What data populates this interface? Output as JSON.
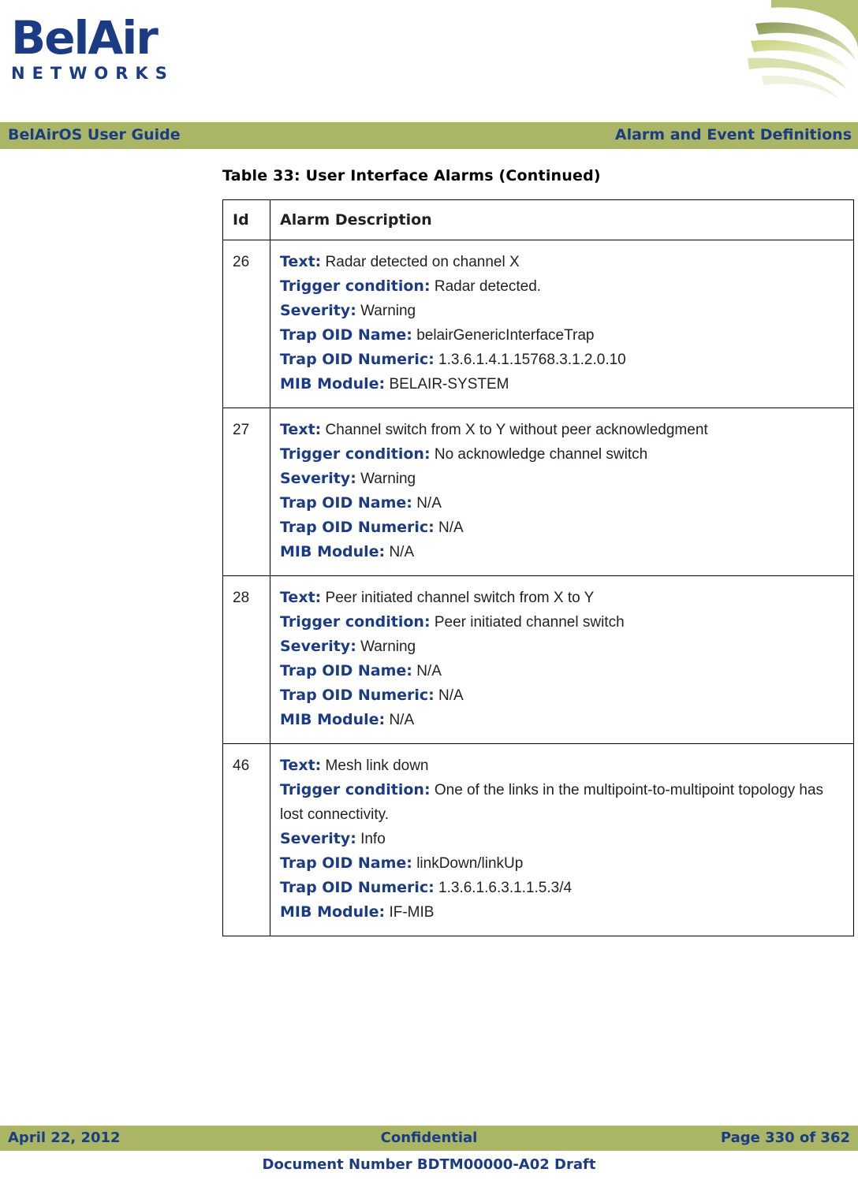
{
  "brand": {
    "logo_main": "BelAir",
    "logo_sub": "NETWORKS",
    "accent_color": "#1b3c84",
    "band_color": "#aab666"
  },
  "header": {
    "left": "BelAirOS User Guide",
    "right": "Alarm and Event Definitions"
  },
  "table": {
    "caption": "Table 33: User Interface Alarms  (Continued)",
    "columns": [
      "Id",
      "Alarm Description"
    ],
    "rows": [
      {
        "id": "26",
        "fields": [
          {
            "label": "Text:",
            "value": "Radar detected on channel X"
          },
          {
            "label": "Trigger condition:",
            "value": "Radar detected."
          },
          {
            "label": "Severity:",
            "value": "Warning"
          },
          {
            "label": "Trap OID Name:",
            "value": "belairGenericInterfaceTrap"
          },
          {
            "label": "Trap OID Numeric:",
            "value": "1.3.6.1.4.1.15768.3.1.2.0.10"
          },
          {
            "label": "MIB Module:",
            "value": "BELAIR-SYSTEM"
          }
        ]
      },
      {
        "id": "27",
        "fields": [
          {
            "label": "Text:",
            "value": "Channel switch from X to Y without peer acknowledgment"
          },
          {
            "label": "Trigger condition:",
            "value": "No acknowledge channel switch"
          },
          {
            "label": "Severity:",
            "value": "Warning"
          },
          {
            "label": "Trap OID Name:",
            "value": "N/A"
          },
          {
            "label": "Trap OID Numeric:",
            "value": "N/A"
          },
          {
            "label": "MIB Module:",
            "value": "N/A"
          }
        ]
      },
      {
        "id": "28",
        "fields": [
          {
            "label": "Text:",
            "value": "Peer initiated channel switch from X to Y"
          },
          {
            "label": "Trigger condition:",
            "value": "Peer initiated channel switch"
          },
          {
            "label": "Severity:",
            "value": "Warning"
          },
          {
            "label": "Trap OID Name:",
            "value": "N/A"
          },
          {
            "label": "Trap OID Numeric:",
            "value": "N/A"
          },
          {
            "label": "MIB Module:",
            "value": "N/A"
          }
        ]
      },
      {
        "id": "46",
        "fields": [
          {
            "label": "Text:",
            "value": "Mesh link down"
          },
          {
            "label": "Trigger condition:",
            "value": "One of the links in the multipoint-to-multipoint topology has lost connectivity."
          },
          {
            "label": "Severity:",
            "value": "Info"
          },
          {
            "label": "Trap OID Name:",
            "value": "linkDown/linkUp"
          },
          {
            "label": "Trap OID Numeric:",
            "value": "1.3.6.1.6.3.1.1.5.3/4"
          },
          {
            "label": "MIB Module:",
            "value": "IF-MIB"
          }
        ]
      }
    ]
  },
  "footer": {
    "date": "April 22, 2012",
    "confidentiality": "Confidential",
    "page": "Page 330 of 362",
    "document_number": "Document Number BDTM00000-A02 Draft"
  }
}
